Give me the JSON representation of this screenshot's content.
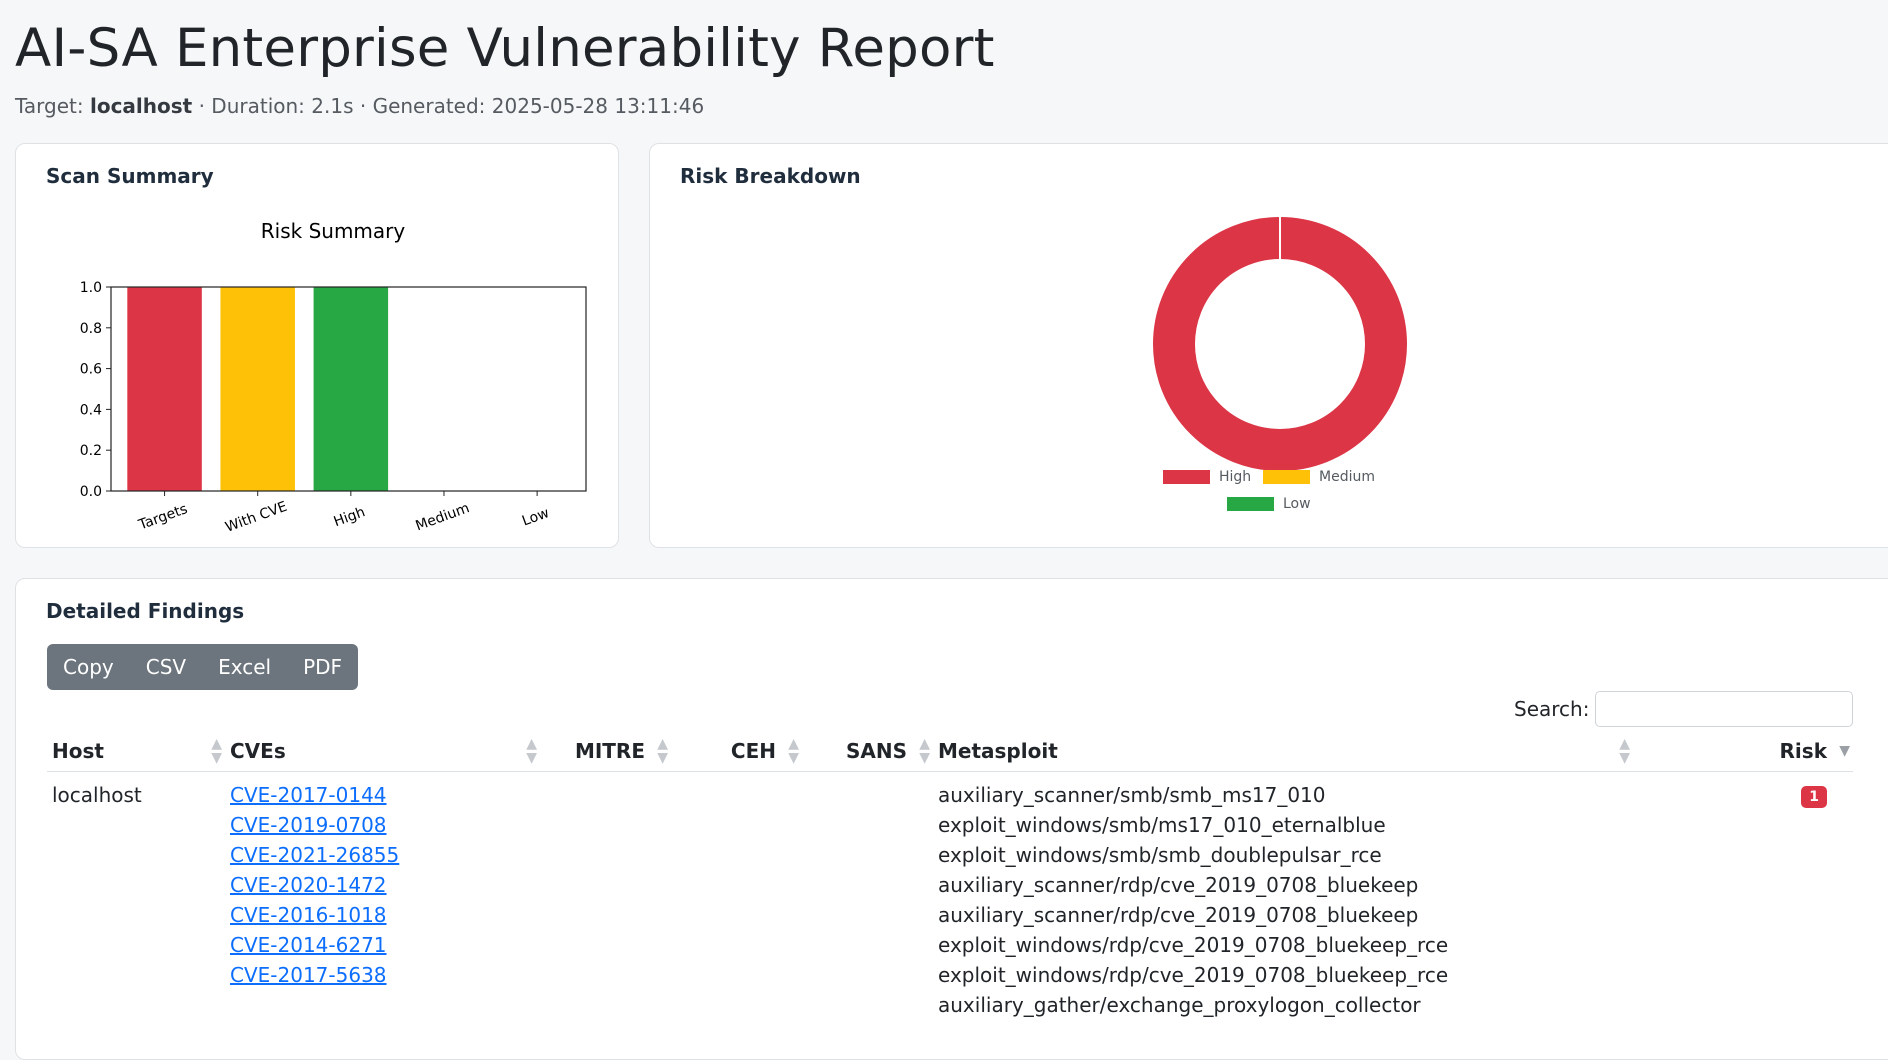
{
  "header": {
    "title": "AI-SA Enterprise Vulnerability Report",
    "target_label": "Target:",
    "target_value": "localhost",
    "rest": "· Duration: 2.1s · Generated: 2025-05-28 13:11:46"
  },
  "scan_summary": {
    "card_title": "Scan Summary",
    "chart_data": {
      "type": "bar",
      "title": "Risk Summary",
      "categories": [
        "Targets",
        "With CVE",
        "High",
        "Medium",
        "Low"
      ],
      "values": [
        1,
        1,
        1,
        0,
        0
      ],
      "colors": [
        "#dc3545",
        "#ffc107",
        "#28a745",
        "#28a745",
        "#28a745"
      ],
      "ylim": [
        0,
        1.0
      ],
      "yticks": [
        "0.0",
        "0.2",
        "0.4",
        "0.6",
        "0.8",
        "1.0"
      ],
      "grid": false
    }
  },
  "risk_breakdown": {
    "card_title": "Risk Breakdown",
    "chart_data": {
      "type": "pie",
      "donut": true,
      "labels": [
        "High",
        "Medium",
        "Low"
      ],
      "values": [
        1,
        0,
        0
      ],
      "colors": [
        "#dc3545",
        "#ffc107",
        "#28a745"
      ],
      "legend_position": "bottom"
    }
  },
  "findings": {
    "card_title": "Detailed Findings",
    "buttons": [
      "Copy",
      "CSV",
      "Excel",
      "PDF"
    ],
    "search_label": "Search:",
    "search_value": "",
    "columns": [
      "Host",
      "CVEs",
      "MITRE",
      "CEH",
      "SANS",
      "Metasploit",
      "Risk"
    ],
    "rows": [
      {
        "host": "localhost",
        "cves": [
          "CVE-2017-0144",
          "CVE-2019-0708",
          "CVE-2021-26855",
          "CVE-2020-1472",
          "CVE-2016-1018",
          "CVE-2014-6271",
          "CVE-2017-5638"
        ],
        "mitre": "",
        "ceh": "",
        "sans": "",
        "metasploit": [
          "auxiliary_scanner/smb/smb_ms17_010",
          "exploit_windows/smb/ms17_010_eternalblue",
          "exploit_windows/smb/smb_doublepulsar_rce",
          "auxiliary_scanner/rdp/cve_2019_0708_bluekeep",
          "auxiliary_scanner/rdp/cve_2019_0708_bluekeep",
          "exploit_windows/rdp/cve_2019_0708_bluekeep_rce",
          "exploit_windows/rdp/cve_2019_0708_bluekeep_rce",
          "auxiliary_gather/exchange_proxylogon_collector"
        ],
        "risk": "1"
      }
    ]
  }
}
